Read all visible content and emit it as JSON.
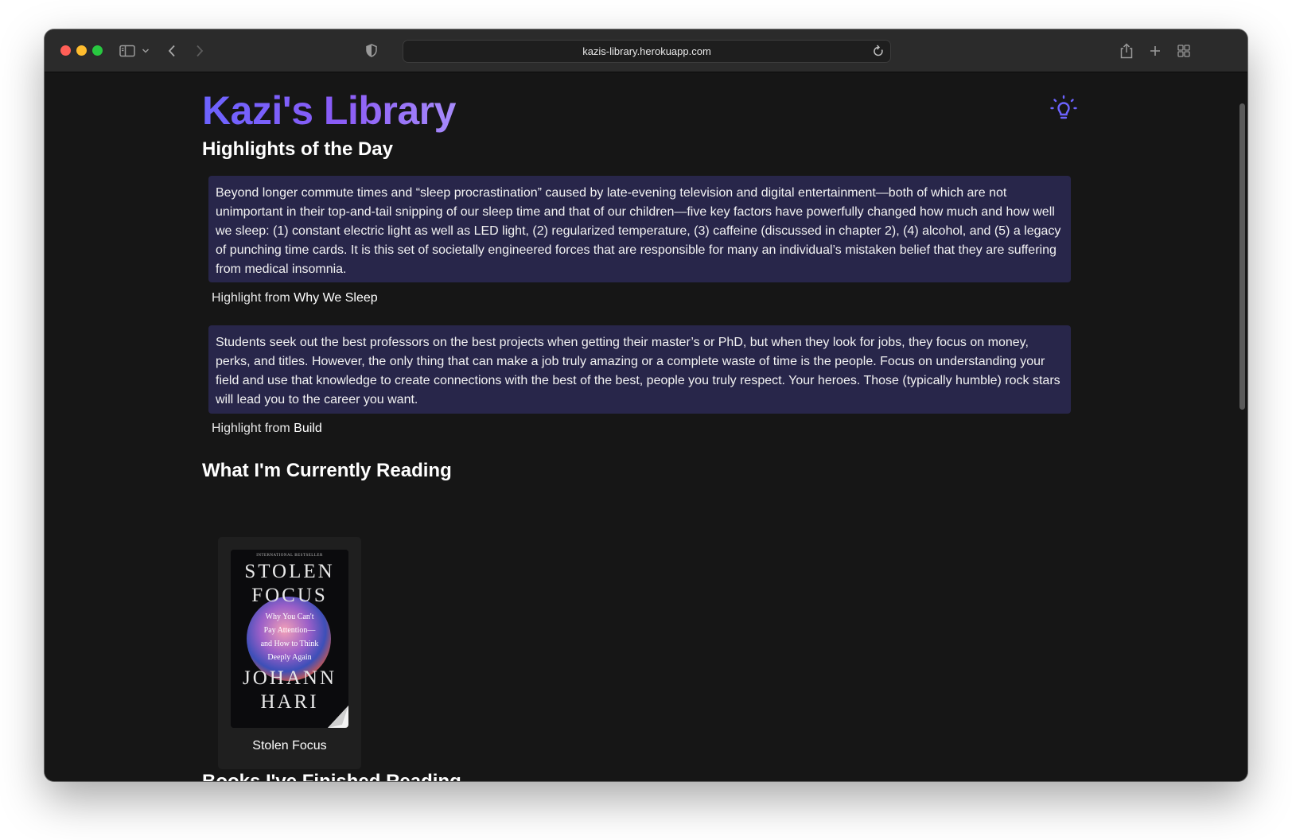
{
  "browser": {
    "url": "kazis-library.herokuapp.com"
  },
  "site": {
    "title": "Kazi's Library"
  },
  "highlights": {
    "heading": "Highlights of the Day",
    "source_prefix": "Highlight from",
    "items": [
      {
        "text": "Beyond longer commute times and “sleep procrastination” caused by late-evening television and digital entertainment—both of which are not unimportant in their top-and-tail snipping of our sleep time and that of our children—five key factors have powerfully changed how much and how well we sleep: (1) constant electric light as well as LED light, (2) regularized temperature, (3) caffeine (discussed in chapter 2), (4) alcohol, and (5) a legacy of punching time cards. It is this set of societally engineered forces that are responsible for many an individual’s mistaken belief that they are suffering from medical insomnia.",
        "book": "Why We Sleep"
      },
      {
        "text": "Students seek out the best professors on the best projects when getting their master’s or PhD, but when they look for jobs, they focus on money, perks, and titles. However, the only thing that can make a job truly amazing or a complete waste of time is the people. Focus on understanding your field and use that knowledge to create connections with the best of the best, people you truly respect. Your heroes. Those (typically humble) rock stars will lead you to the career you want.",
        "book": "Build"
      }
    ]
  },
  "currently_reading": {
    "heading": "What I'm Currently Reading",
    "books": [
      {
        "title": "Stolen Focus",
        "cover": {
          "banner": "INTERNATIONAL BESTSELLER",
          "title_line1": "STOLEN",
          "title_line2": "FOCUS",
          "subtitle_lines": [
            "Why You Can't",
            "Pay Attention—",
            "and How to Think",
            "Deeply Again"
          ],
          "author_line1": "JOHANN",
          "author_line2": "HARI"
        }
      }
    ]
  },
  "finished_reading": {
    "heading": "Books I've Finished Reading"
  }
}
